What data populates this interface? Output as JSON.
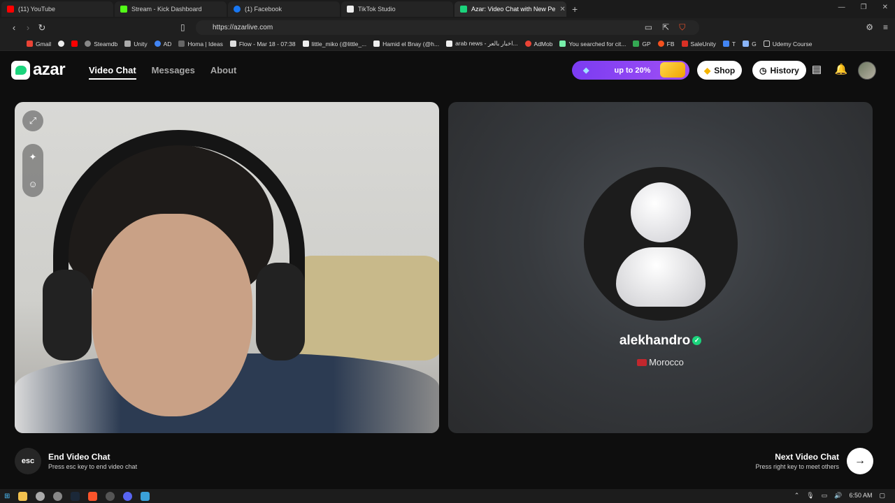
{
  "browser": {
    "tabs": [
      {
        "title": "(11) YouTube",
        "color": "#ff0000",
        "active": false
      },
      {
        "title": "Stream - Kick Dashboard",
        "color": "#53fc18",
        "active": false
      },
      {
        "title": "(1) Facebook",
        "color": "#1877f2",
        "active": false
      },
      {
        "title": "TikTok Studio",
        "color": "#ffffff",
        "active": false
      },
      {
        "title": "Azar: Video Chat with New Pe",
        "color": "#1bd47c",
        "active": true
      }
    ],
    "url": "https://azarlive.com",
    "bookmarks": [
      "Gmail",
      "",
      "",
      "Steamdb",
      "Unity",
      "AD",
      "Homa | Ideas",
      "Flow - Mar 18 - 07:38",
      "little_miko (@little_...",
      "Hamid el Bnay (@h...",
      "arab news - اخبار بالعر...",
      "AdMob",
      "You searched for cit...",
      "GP",
      "FB",
      "SaleUnity",
      "T",
      "G",
      "Udemy Course"
    ]
  },
  "site": {
    "logo_text": "azar",
    "nav": [
      {
        "label": "Video Chat",
        "active": true
      },
      {
        "label": "Messages",
        "active": false
      },
      {
        "label": "About",
        "active": false
      }
    ],
    "promo_label": "up to 20%",
    "shop_label": "Shop",
    "history_label": "History"
  },
  "remote": {
    "name": "alekhandro",
    "country": "Morocco"
  },
  "controls": {
    "esc_label": "esc",
    "end_title": "End Video Chat",
    "end_sub": "Press esc key to end video chat",
    "next_title": "Next Video Chat",
    "next_sub": "Press right key to meet others"
  },
  "taskbar": {
    "time": "6:50 AM"
  }
}
